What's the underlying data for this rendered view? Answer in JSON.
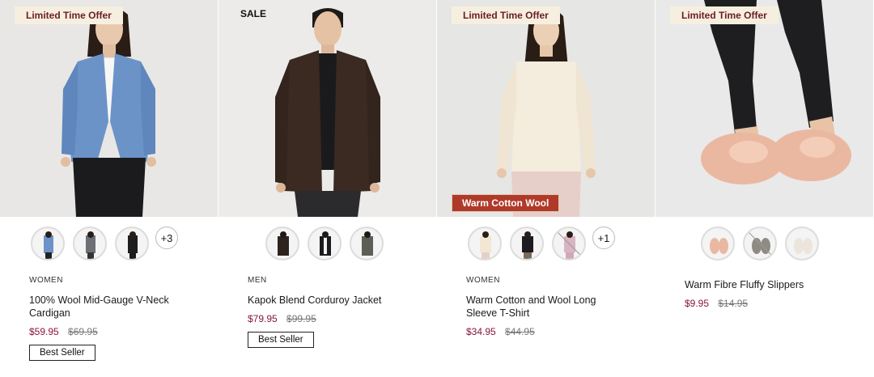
{
  "products": [
    {
      "badge": "Limited Time Offer",
      "image_icon": "woman-blue-cardigan",
      "swatches": [
        "blue-cardigan-icon",
        "grey-cardigan-icon",
        "black-cardigan-icon"
      ],
      "more_colors": "+3",
      "category": "WOMEN",
      "name": "100% Wool Mid-Gauge V-Neck Cardigan",
      "price": "$59.95",
      "original_price": "$69.95",
      "tag": "Best Seller"
    },
    {
      "badge": "SALE",
      "image_icon": "man-corduroy-jacket",
      "swatches": [
        "dark-brown-jacket-icon",
        "black-jacket-icon",
        "khaki-jacket-icon"
      ],
      "more_colors": "",
      "category": "MEN",
      "name": "Kapok Blend Corduroy Jacket",
      "price": "$79.95",
      "original_price": "$99.95",
      "tag": "Best Seller"
    },
    {
      "badge": "Limited Time Offer",
      "image_icon": "woman-cream-tshirt",
      "image_label": "Warm Cotton Wool",
      "swatches": [
        "cream-tshirt-icon",
        "black-tshirt-icon",
        "pink-tshirt-icon"
      ],
      "more_colors": "+1",
      "category": "WOMEN",
      "name": "Warm Cotton and Wool Long Sleeve T-Shirt",
      "price": "$34.95",
      "original_price": "$44.95",
      "tag": ""
    },
    {
      "badge": "Limited Time Offer",
      "image_icon": "pink-fluffy-slippers",
      "swatches": [
        "pink-slippers-icon",
        "grey-slippers-icon",
        "ivory-slippers-icon"
      ],
      "more_colors": "",
      "category": "",
      "name": "Warm Fibre Fluffy Slippers",
      "price": "$9.95",
      "original_price": "$14.95",
      "tag": ""
    }
  ],
  "colors": {
    "sale_price": "#8a1538",
    "offer_badge_bg": "#f6efe0",
    "offer_badge_text": "#6b1d24",
    "label_bg": "#b03a2a"
  }
}
